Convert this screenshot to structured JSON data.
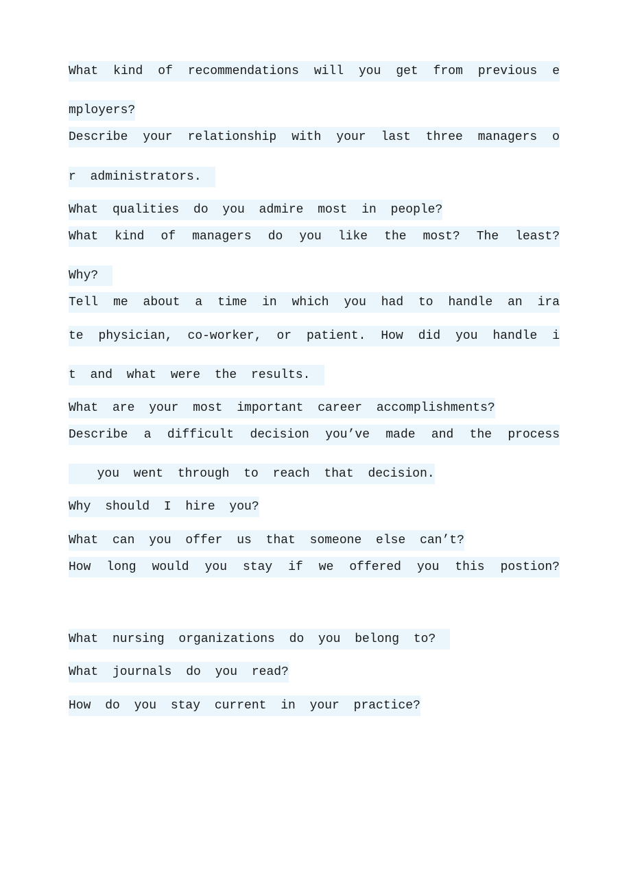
{
  "lines": [
    {
      "text": "What kind of recommendations will you get from previous e",
      "full": true
    },
    {
      "text": "mployers?",
      "full": false
    },
    {
      "text": "Describe your relationship with your last three managers o",
      "full": true
    },
    {
      "text": "r administrators. ",
      "full": false
    },
    {
      "text": "What qualities do you admire most in people?",
      "full": false
    },
    {
      "text": "What kind of managers do you like the most? The least? ",
      "full": true
    },
    {
      "text": "Why? ",
      "full": false
    },
    {
      "text": "Tell me about a time in which you had to handle an ira",
      "full": true
    },
    {
      "text": "te physician, co-worker, or patient. How did you handle i",
      "full": true
    },
    {
      "text": "t and what were the results. ",
      "full": false
    },
    {
      "text": "What are your most important career accomplishments?",
      "full": false
    },
    {
      "text": "Describe a difficult decision you’ve made and the process",
      "full": true
    },
    {
      "text": "  you went through to reach that decision.",
      "full": false
    },
    {
      "text": "Why should I hire you?",
      "full": false
    },
    {
      "text": "What can you offer us that someone else can’t?",
      "full": false
    },
    {
      "text": "How long would you stay if we offered you this postion?",
      "full": true
    },
    {
      "text": "",
      "full": false
    },
    {
      "text": "What nursing organizations do you belong to? ",
      "full": false
    },
    {
      "text": "What journals do you read?",
      "full": false
    },
    {
      "text": "How do you stay current in your practice?",
      "full": false
    }
  ]
}
